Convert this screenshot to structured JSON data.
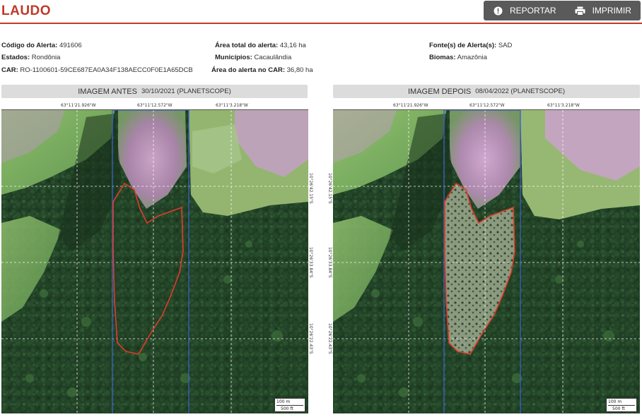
{
  "header": {
    "title": "LAUDO",
    "report_label": "REPORTAR",
    "print_label": "IMPRIMIR",
    "accent": "#c0392b",
    "button_bg": "#5a5a5a"
  },
  "info": {
    "codigo_label": "Código do Alerta:",
    "codigo_value": "491606",
    "estados_label": "Estados:",
    "estados_value": "Rondônia",
    "car_label": "CAR:",
    "car_value": "RO-1100601-59CE687EA0A34F138AECC0F0E1A65DCB",
    "area_total_label": "Área total do alerta:",
    "area_total_value": "43,16 ha",
    "municipios_label": "Municípios:",
    "municipios_value": "Cacaulândia",
    "area_car_label": "Área do alerta no CAR:",
    "area_car_value": "36,80 ha",
    "fonte_label": "Fonte(s) de Alerta(s):",
    "fonte_value": "SAD",
    "biomas_label": "Biomas:",
    "biomas_value": "Amazônia"
  },
  "panels": {
    "before": {
      "title": "IMAGEM ANTES",
      "subtitle": "30/10/2021 (PLANETSCOPE)"
    },
    "after": {
      "title": "IMAGEM DEPOIS",
      "subtitle": "08/04/2022 (PLANETSCOPE)"
    }
  },
  "coords": {
    "lon1": "63°11'21.926\"W",
    "lon2": "63°11'12.572\"W",
    "lon3": "63°11'3.218\"W",
    "lat1": "10°26'42.15\"S",
    "lat2": "10°26'33.84\"S",
    "lat3": "10°26'22.43\"S"
  },
  "scale": {
    "meters": "100 m",
    "feet": "500 ft"
  }
}
